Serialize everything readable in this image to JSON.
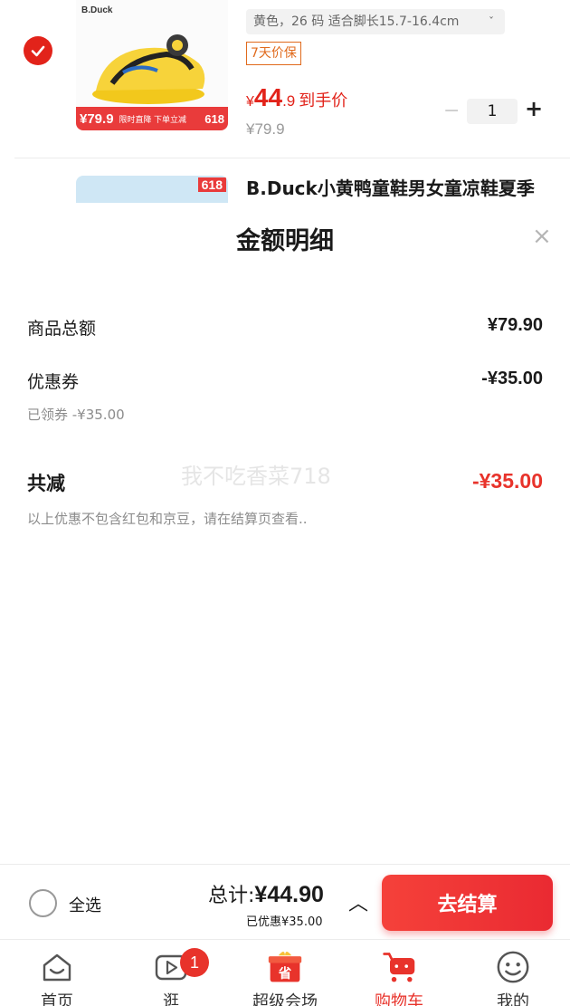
{
  "cart": {
    "item1": {
      "brand_logo": "B.Duck",
      "promo_price": "¥79.9",
      "promo_text": "限时直降 下单立减",
      "promo_badge": "618",
      "spec": "黄色，26 码 适合脚长15.7-16.4cm",
      "spec_chevron": "ˇ",
      "tag": "7天价保",
      "price_yen": "¥",
      "price_int": "44",
      "price_dec": ".9",
      "price_label": "到手价",
      "orig_price": "¥79.9",
      "qty_minus": "−",
      "qty": "1",
      "qty_plus": "+"
    },
    "item2": {
      "badge": "618",
      "title": "B.Duck小黄鸭童鞋男女童凉鞋夏季"
    }
  },
  "sheet": {
    "title": "金额明细",
    "close": "×",
    "goods_total_label": "商品总额",
    "goods_total_value": "¥79.90",
    "coupon_label": "优惠券",
    "coupon_value": "-¥35.00",
    "coupon_sub": "已领券 -¥35.00",
    "total_reduce_label": "共减",
    "total_reduce_value": "-¥35.00",
    "note": "以上优惠不包含红包和京豆，请在结算页查看..",
    "watermark": "我不吃香菜718"
  },
  "checkout": {
    "select_all": "全选",
    "total_label": "总计:",
    "total_value": "¥44.90",
    "saved": "已优惠¥35.00",
    "caret": "︿",
    "go_button": "去结算"
  },
  "tabs": [
    {
      "label": "首页",
      "icon": "home-icon"
    },
    {
      "label": "逛",
      "icon": "video-play-icon"
    },
    {
      "label": "超级会场",
      "icon": "gift-icon"
    },
    {
      "label": "购物车",
      "icon": "cart-icon"
    },
    {
      "label": "我的",
      "icon": "smiley-icon"
    }
  ],
  "tab_badge": "1",
  "colors": {
    "accent": "#e8332b",
    "tag_orange": "#e06a1c"
  }
}
